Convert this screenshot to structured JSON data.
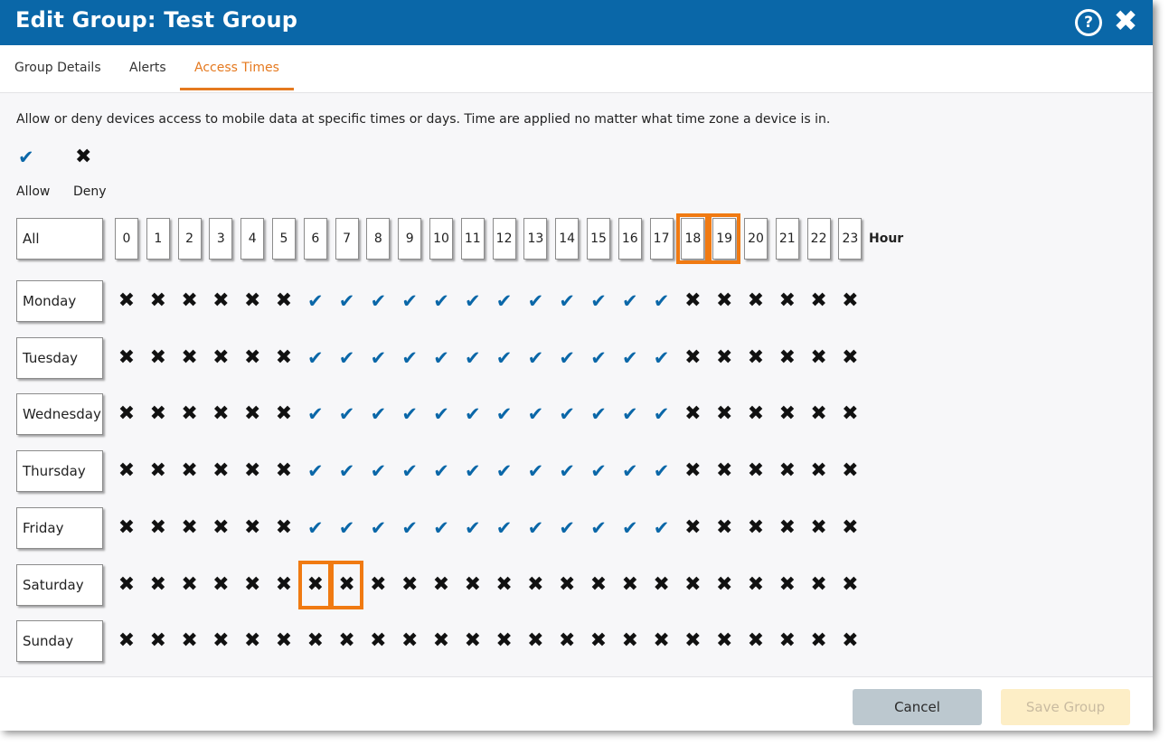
{
  "header": {
    "title": "Edit Group: Test Group",
    "help_icon": "question-circle-icon",
    "help_glyph": "?",
    "close_icon": "close-icon",
    "close_glyph": "✖"
  },
  "tabs": [
    {
      "label": "Group Details",
      "active": false
    },
    {
      "label": "Alerts",
      "active": false
    },
    {
      "label": "Access Times",
      "active": true
    }
  ],
  "description": "Allow or deny devices access to mobile data at specific times or days. Time are applied no matter what time zone a device is in.",
  "legend": {
    "allow": {
      "label": "Allow",
      "icon": "checkmark-icon",
      "glyph": "✔"
    },
    "deny": {
      "label": "Deny",
      "icon": "x-icon",
      "glyph": "✖"
    }
  },
  "grid": {
    "all_label": "All",
    "hour_label": "Hour",
    "hours": [
      "0",
      "1",
      "2",
      "3",
      "4",
      "5",
      "6",
      "7",
      "8",
      "9",
      "10",
      "11",
      "12",
      "13",
      "14",
      "15",
      "16",
      "17",
      "18",
      "19",
      "20",
      "21",
      "22",
      "23"
    ],
    "days": [
      {
        "label": "Monday",
        "pattern": "DDDDDDAAAAAAAAAAAADDDDDD"
      },
      {
        "label": "Tuesday",
        "pattern": "DDDDDDAAAAAAAAAAAADDDDDD"
      },
      {
        "label": "Wednesday",
        "pattern": "DDDDDDAAAAAAAAAAAADDDDDD"
      },
      {
        "label": "Thursday",
        "pattern": "DDDDDDAAAAAAAAAAAADDDDDD"
      },
      {
        "label": "Friday",
        "pattern": "DDDDDDAAAAAAAAAAAADDDDDD"
      },
      {
        "label": "Saturday",
        "pattern": "DDDDDDDDDDDDDDDDDDDDDDDD"
      },
      {
        "label": "Sunday",
        "pattern": "DDDDDDDDDDDDDDDDDDDDDDDD"
      }
    ],
    "highlight_color": "#f07a12",
    "highlighted_hours": [
      "18",
      "19"
    ],
    "highlighted_cells": [
      {
        "day": "Saturday",
        "hour": "6"
      },
      {
        "day": "Saturday",
        "hour": "7"
      }
    ]
  },
  "footer": {
    "cancel_label": "Cancel",
    "save_label": "Save Group",
    "save_enabled": false
  },
  "colors": {
    "header_bg": "#0a67a8",
    "accent": "#e5791f",
    "allow": "#0a67a8",
    "deny": "#111111"
  }
}
